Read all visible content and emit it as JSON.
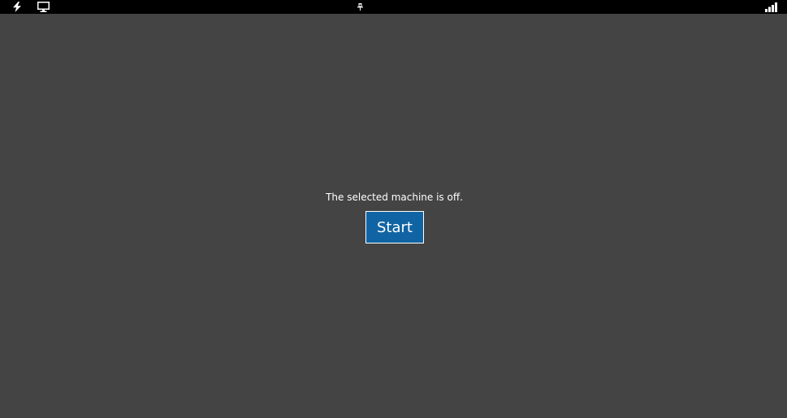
{
  "toolbar": {
    "icons": [
      "power-icon",
      "monitor-icon",
      "pin-icon",
      "signal-icon"
    ]
  },
  "main": {
    "message": "The selected machine is off.",
    "start_label": "Start"
  },
  "colors": {
    "background": "#444444",
    "topbar": "#000000",
    "button": "#1064a3",
    "text": "#ffffff"
  }
}
